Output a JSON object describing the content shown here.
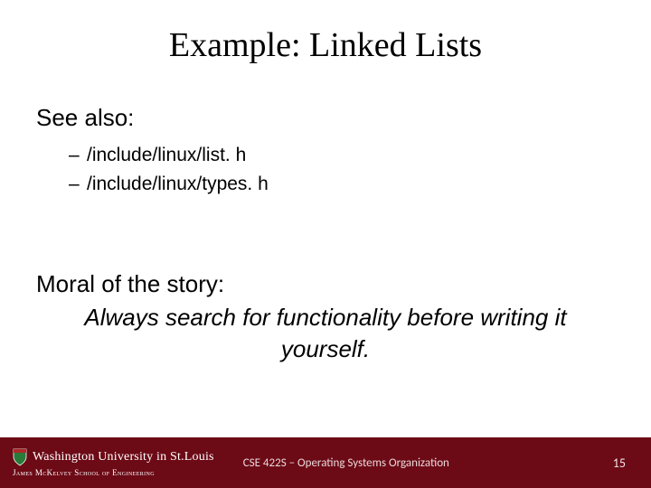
{
  "title": "Example: Linked Lists",
  "see_also": {
    "heading": "See also:",
    "items": [
      "/include/linux/list. h",
      "/include/linux/types. h"
    ]
  },
  "moral": {
    "heading": "Moral of the story:",
    "text": "Always search for functionality before writing it yourself."
  },
  "footer": {
    "university": "Washington University in St.Louis",
    "school": "James McKelvey School of Engineering",
    "course": "CSE 422S – Operating Systems Organization",
    "page": "15"
  }
}
